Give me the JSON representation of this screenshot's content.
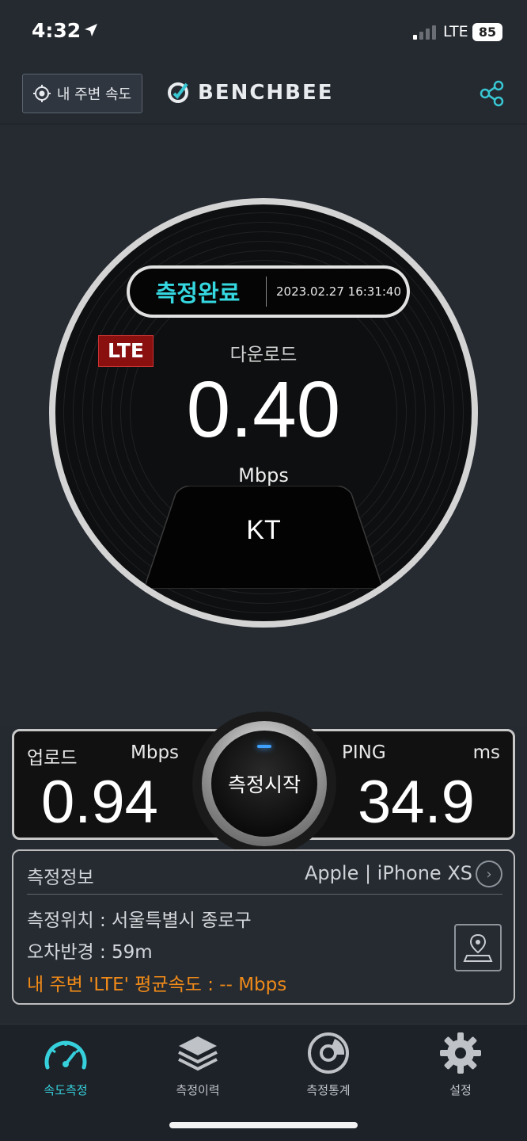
{
  "status_bar": {
    "time": "4:32",
    "network": "LTE",
    "battery": "85"
  },
  "header": {
    "nearby_button": "내 주변 속도",
    "logo_text": "BENCHBEE",
    "share_icon": "share-icon"
  },
  "gauge": {
    "status": "측정완료",
    "timestamp": "2023.02.27 16:31:40",
    "network_badge": "LTE",
    "download_label": "다운로드",
    "download_value": "0.40",
    "download_unit": "Mbps",
    "carrier": "KT"
  },
  "results": {
    "upload_label": "업로드",
    "upload_unit": "Mbps",
    "upload_value": "0.94",
    "ping_label": "PING",
    "ping_unit": "ms",
    "ping_value": "34.9",
    "start_button": "측정시작"
  },
  "info": {
    "title": "측정정보",
    "device": "Apple | iPhone XS",
    "location": "측정위치 : 서울특별시 종로구",
    "error_radius": "오차반경 : 59m",
    "nearby_avg": "내 주변 'LTE' 평균속도 : -- Mbps"
  },
  "tabs": [
    {
      "label": "속도측정",
      "icon": "speedometer-icon",
      "active": true
    },
    {
      "label": "측정이력",
      "icon": "layers-icon",
      "active": false
    },
    {
      "label": "측정통계",
      "icon": "stats-disc-icon",
      "active": false
    },
    {
      "label": "설정",
      "icon": "gear-icon",
      "active": false
    }
  ],
  "colors": {
    "accent": "#36d0dc",
    "warning": "#f08a18",
    "badge": "#8a0f0f"
  }
}
